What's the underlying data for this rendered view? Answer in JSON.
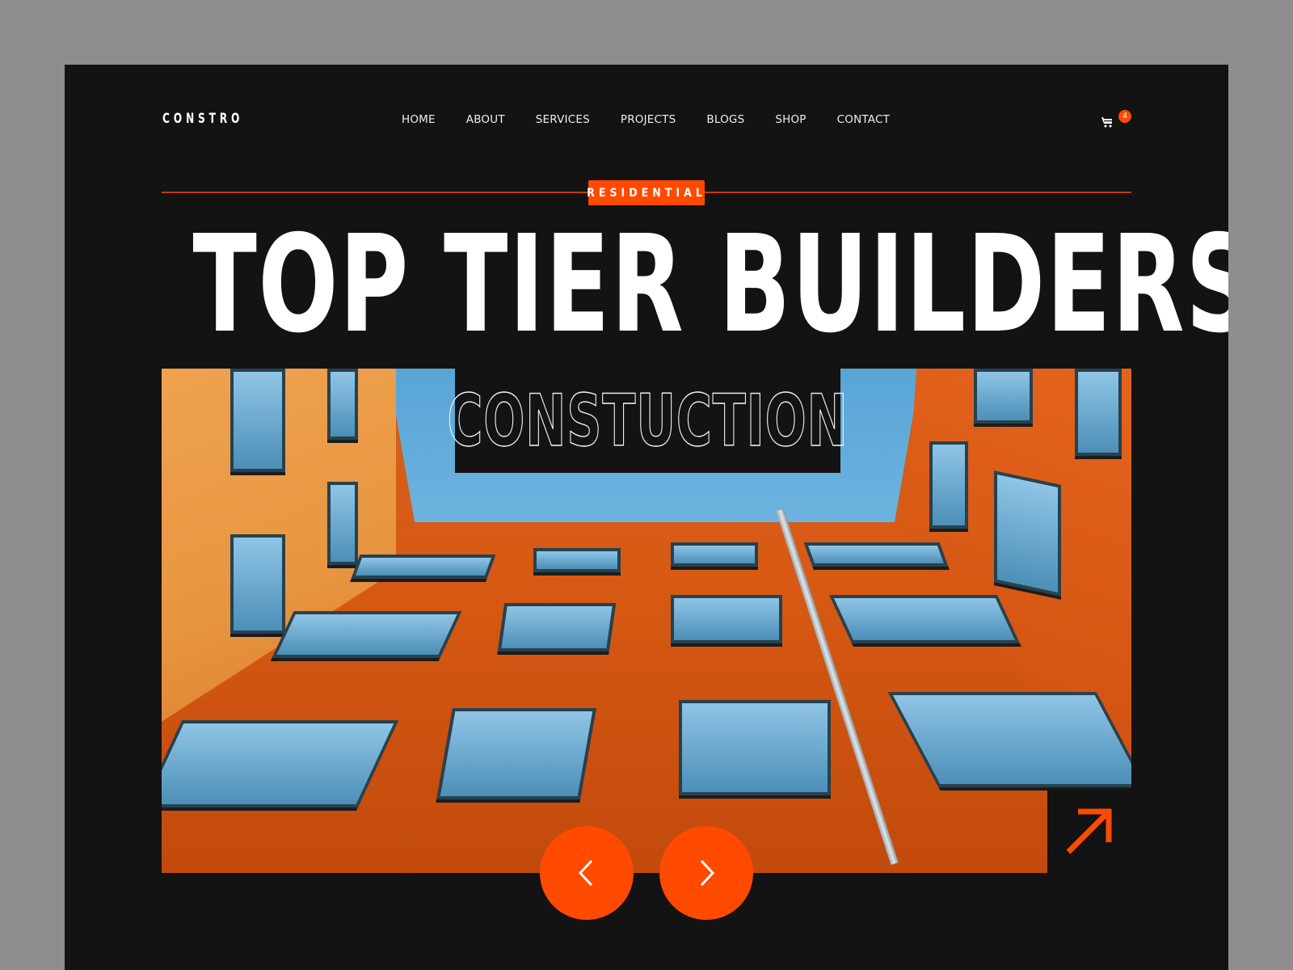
{
  "header": {
    "logo": "CONSTRO",
    "nav": [
      "HOME",
      "ABOUT",
      "SERVICES",
      "PROJECTS",
      "BLOGS",
      "SHOP",
      "CONTACT"
    ],
    "cart": {
      "icon": "cart-icon",
      "count": "4"
    }
  },
  "hero": {
    "tag": "RESIDENTIAL",
    "headline": "TOP TIER BUILDERS",
    "overlay_text": "CONSTUCTION",
    "image_alt": "Low-angle view of orange courtyard buildings against blue sky",
    "link_icon": "arrow-up-right-icon",
    "controls": {
      "prev_icon": "chevron-left-icon",
      "next_icon": "chevron-right-icon"
    }
  },
  "colors": {
    "accent": "#ff4a00",
    "background": "#131313",
    "canvas": "#8f8d8e",
    "text": "#ffffff"
  }
}
